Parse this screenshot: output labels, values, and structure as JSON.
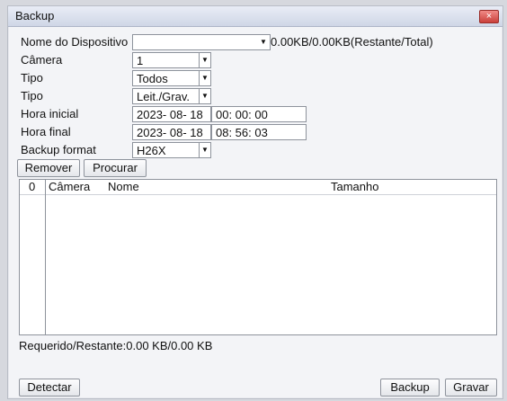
{
  "window": {
    "title": "Backup",
    "close_glyph": "×"
  },
  "form": {
    "device_label": "Nome do Dispositivo",
    "device_value": "",
    "capacity_text": "0.00KB/0.00KB(Restante/Total)",
    "camera_label": "Câmera",
    "camera_value": "1",
    "type1_label": "Tipo",
    "type1_value": "Todos",
    "type2_label": "Tipo",
    "type2_value": "Leit./Grav.",
    "start_label": "Hora inicial",
    "start_date": "2023- 08- 18",
    "start_time": "00: 00: 00",
    "end_label": "Hora final",
    "end_date": "2023- 08- 18",
    "end_time": "08: 56: 03",
    "format_label": "Backup format",
    "format_value": "H26X",
    "dropdown_glyph": "▼"
  },
  "actions": {
    "remove": "Remover",
    "search": "Procurar"
  },
  "table": {
    "headers": {
      "index": "0",
      "camera": "Câmera",
      "name": "Nome",
      "size": "Tamanho"
    },
    "rows": []
  },
  "status": {
    "required_text": "Requerido/Restante:0.00 KB/0.00 KB"
  },
  "footer": {
    "detect": "Detectar",
    "backup": "Backup",
    "record": "Gravar"
  },
  "colors": {
    "window_bg": "#f3f4f7",
    "close_button": "#c9403b"
  }
}
